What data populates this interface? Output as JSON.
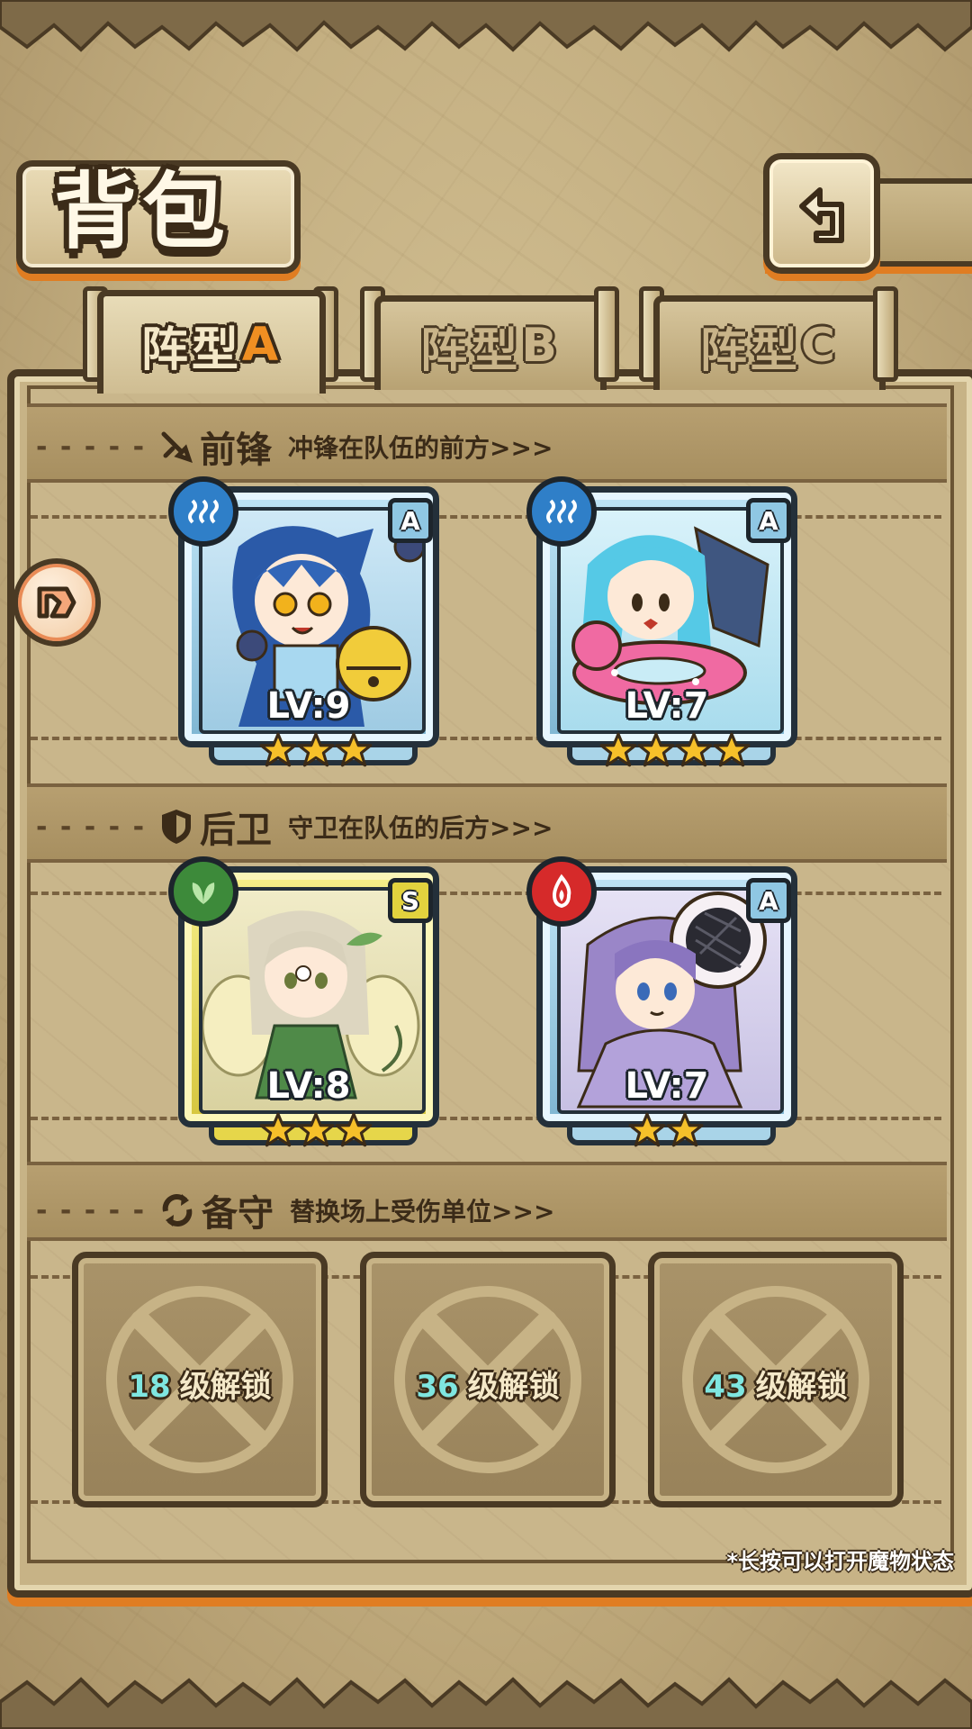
{
  "header": {
    "title": "背包",
    "back_icon": "return-arrow-icon"
  },
  "tabs": [
    {
      "prefix": "阵型",
      "letter": "A",
      "active": true
    },
    {
      "prefix": "阵型",
      "letter": "B",
      "active": false
    },
    {
      "prefix": "阵型",
      "letter": "C",
      "active": false
    }
  ],
  "side_button_icon": "arrow-right-circle-icon",
  "sections": {
    "front": {
      "icon": "sword-icon",
      "name": "前锋",
      "desc": "冲锋在队伍的前方>>>"
    },
    "back": {
      "icon": "shield-icon",
      "name": "后卫",
      "desc": "守卫在队伍的后方>>>"
    },
    "reserve": {
      "icon": "swap-icon",
      "name": "备守",
      "desc": "替换场上受伤单位>>>"
    }
  },
  "monsters": [
    {
      "slot": "front-1",
      "element": "water",
      "rank": "A",
      "level": "LV:9",
      "stars": 3
    },
    {
      "slot": "front-2",
      "element": "water",
      "rank": "A",
      "level": "LV:7",
      "stars": 4
    },
    {
      "slot": "back-1",
      "element": "wood",
      "rank": "S",
      "level": "LV:8",
      "stars": 3
    },
    {
      "slot": "back-2",
      "element": "fire",
      "rank": "A",
      "level": "LV:7",
      "stars": 2
    }
  ],
  "reserve_slots": [
    {
      "level": "18",
      "label": "级解锁"
    },
    {
      "level": "36",
      "label": "级解锁"
    },
    {
      "level": "43",
      "label": "级解锁"
    }
  ],
  "hint": "*长按可以打开魔物状态",
  "colors": {
    "accent_orange": "#e07d22",
    "outline": "#4a3a24",
    "water": "#2f7fc8",
    "wood": "#3d8a3a",
    "fire": "#d62a2a",
    "rank_a": "#7fb6d3",
    "rank_s": "#d6c63e"
  }
}
